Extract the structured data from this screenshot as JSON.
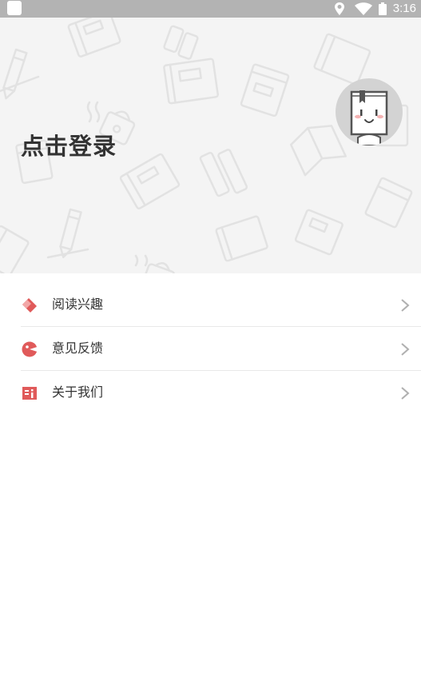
{
  "status_bar": {
    "time": "3:16",
    "icons": [
      "app-notification-icon",
      "location-icon",
      "wifi-icon",
      "battery-icon"
    ]
  },
  "header": {
    "login_label": "点击登录",
    "avatar_icon": "book-mascot-avatar"
  },
  "menu": {
    "items": [
      {
        "label": "阅读兴趣",
        "icon": "bookmark-tag-icon"
      },
      {
        "label": "意见反馈",
        "icon": "feedback-pie-icon"
      },
      {
        "label": "关于我们",
        "icon": "about-book-icon"
      }
    ],
    "arrow_icon": "chevron-right-icon"
  },
  "colors": {
    "accent": "#e05a5a",
    "status_bar": "#b3b3b3",
    "header_bg": "#f4f4f4",
    "text": "#333333"
  }
}
